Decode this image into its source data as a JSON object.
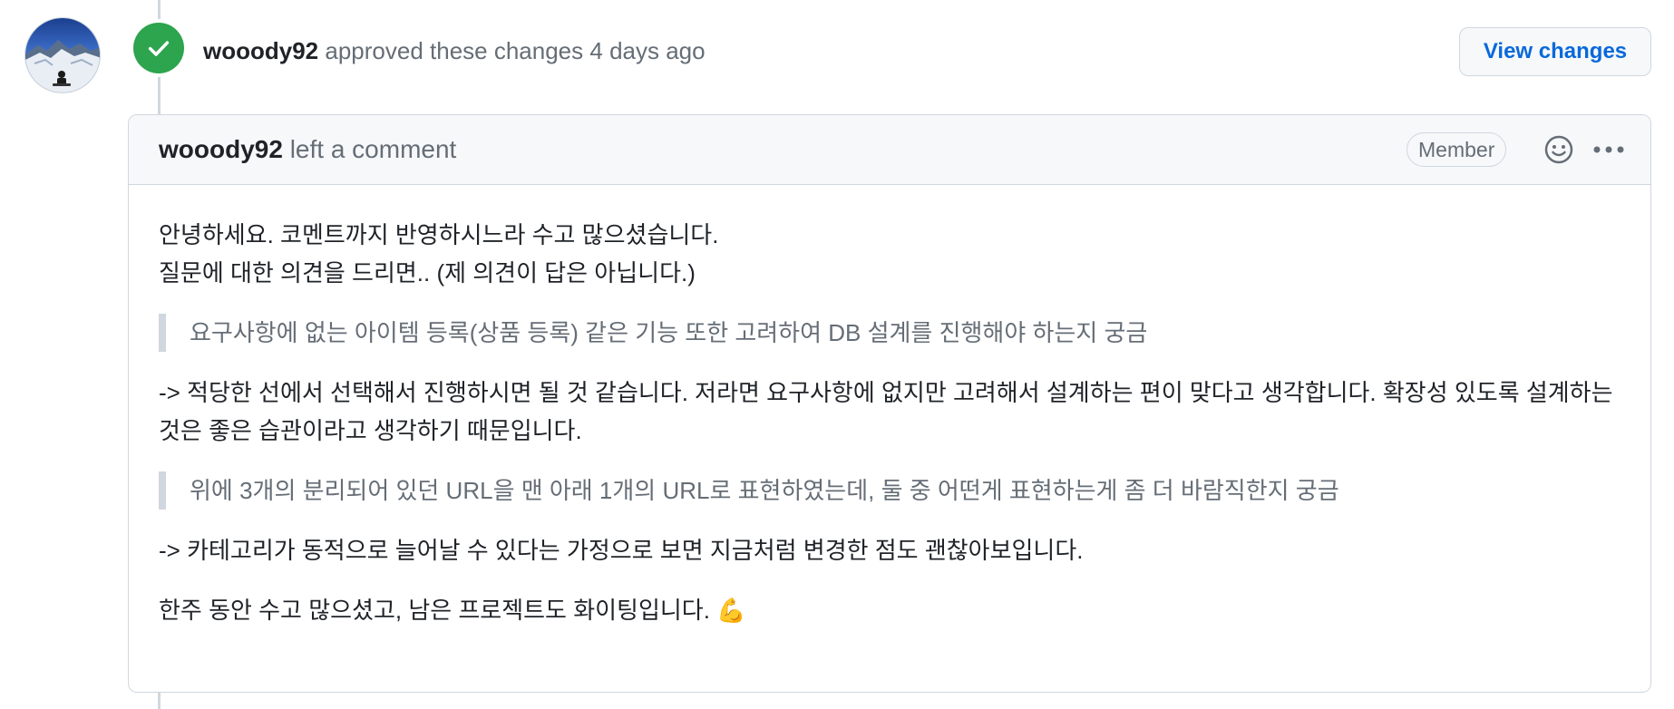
{
  "review": {
    "author": "wooody92",
    "action_text": "approved these changes",
    "time_ago": "4 days ago",
    "view_changes_label": "View changes"
  },
  "comment": {
    "author": "wooody92",
    "action_text": "left a comment",
    "role_badge": "Member",
    "body": {
      "greeting_line1": "안녕하세요. 코멘트까지 반영하시느라 수고 많으셨습니다.",
      "greeting_line2": "질문에 대한 의견을 드리면.. (제 의견이 답은 아닙니다.)",
      "quote1": "요구사항에 없는 아이템 등록(상품 등록) 같은 기능 또한 고려하여 DB 설계를 진행해야 하는지 궁금",
      "answer1": "-> 적당한 선에서 선택해서 진행하시면 될 것 같습니다. 저라면 요구사항에 없지만 고려해서 설계하는 편이 맞다고 생각합니다. 확장성 있도록 설계하는 것은 좋은 습관이라고 생각하기 때문입니다.",
      "quote2": "위에 3개의 분리되어 있던 URL을 맨 아래 1개의 URL로 표현하였는데, 둘 중 어떤게 표현하는게 좀 더 바람직한지 궁금",
      "answer2": "-> 카테고리가 동적으로 늘어날 수 있다는 가정으로 보면 지금처럼 변경한 점도 괜찮아보입니다.",
      "closing": "한주 동안 수고 많으셨고, 남은 프로젝트도 화이팅입니다.",
      "closing_emoji": "💪"
    }
  },
  "icons": {
    "avatar": "avatar-photo",
    "approved": "check-icon",
    "reaction": "smiley-icon",
    "menu": "kebab-horizontal-icon"
  },
  "colors": {
    "approved_green": "#2da44e",
    "link_blue": "#0969da",
    "muted_text": "#656d76",
    "border": "#d0d7de",
    "header_bg": "#f6f8fa"
  }
}
